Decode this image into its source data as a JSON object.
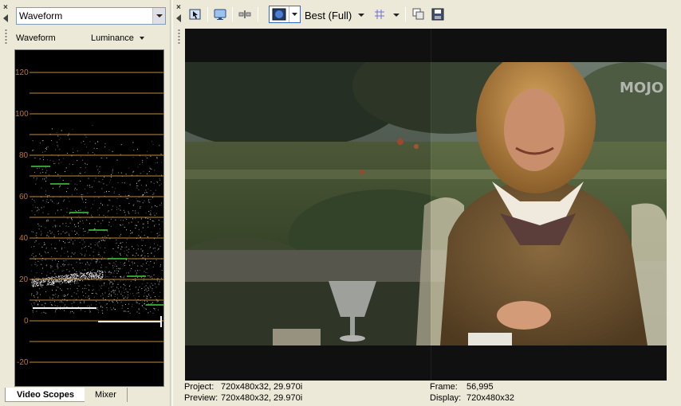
{
  "left_panel": {
    "scope_select_value": "Waveform",
    "scope_title": "Waveform",
    "scope_mode": "Luminance",
    "scale_labels": [
      "120",
      "100",
      "80",
      "60",
      "40",
      "20",
      "0",
      "-20"
    ],
    "tabs": [
      {
        "label": "Video Scopes",
        "active": true
      },
      {
        "label": "Mixer",
        "active": false
      }
    ]
  },
  "toolbar": {
    "quality": "Best (Full)"
  },
  "preview": {
    "watermark": "MOJO"
  },
  "status": {
    "project_label": "Project:",
    "project_value": "720x480x32, 29.970i",
    "preview_label": "Preview:",
    "preview_value": "720x480x32, 29.970i",
    "frame_label": "Frame:",
    "frame_value": "56,995",
    "display_label": "Display:",
    "display_value": "720x480x32"
  },
  "colors": {
    "grid": "#c18a3c",
    "grid_label": "#c5732c",
    "trace": "#e8e8e8",
    "markers": "#3fd23f",
    "panel_bg": "#ece9d8",
    "accent": "#316ac5"
  },
  "icons": {
    "close": "close-icon",
    "collapse": "collapse-left-icon",
    "properties": "properties-icon",
    "monitor": "external-monitor-icon",
    "split": "split-screen-icon",
    "overlay": "overlay-icon",
    "grid": "grid-icon",
    "copy": "copy-snapshot-icon",
    "save": "save-snapshot-icon"
  }
}
